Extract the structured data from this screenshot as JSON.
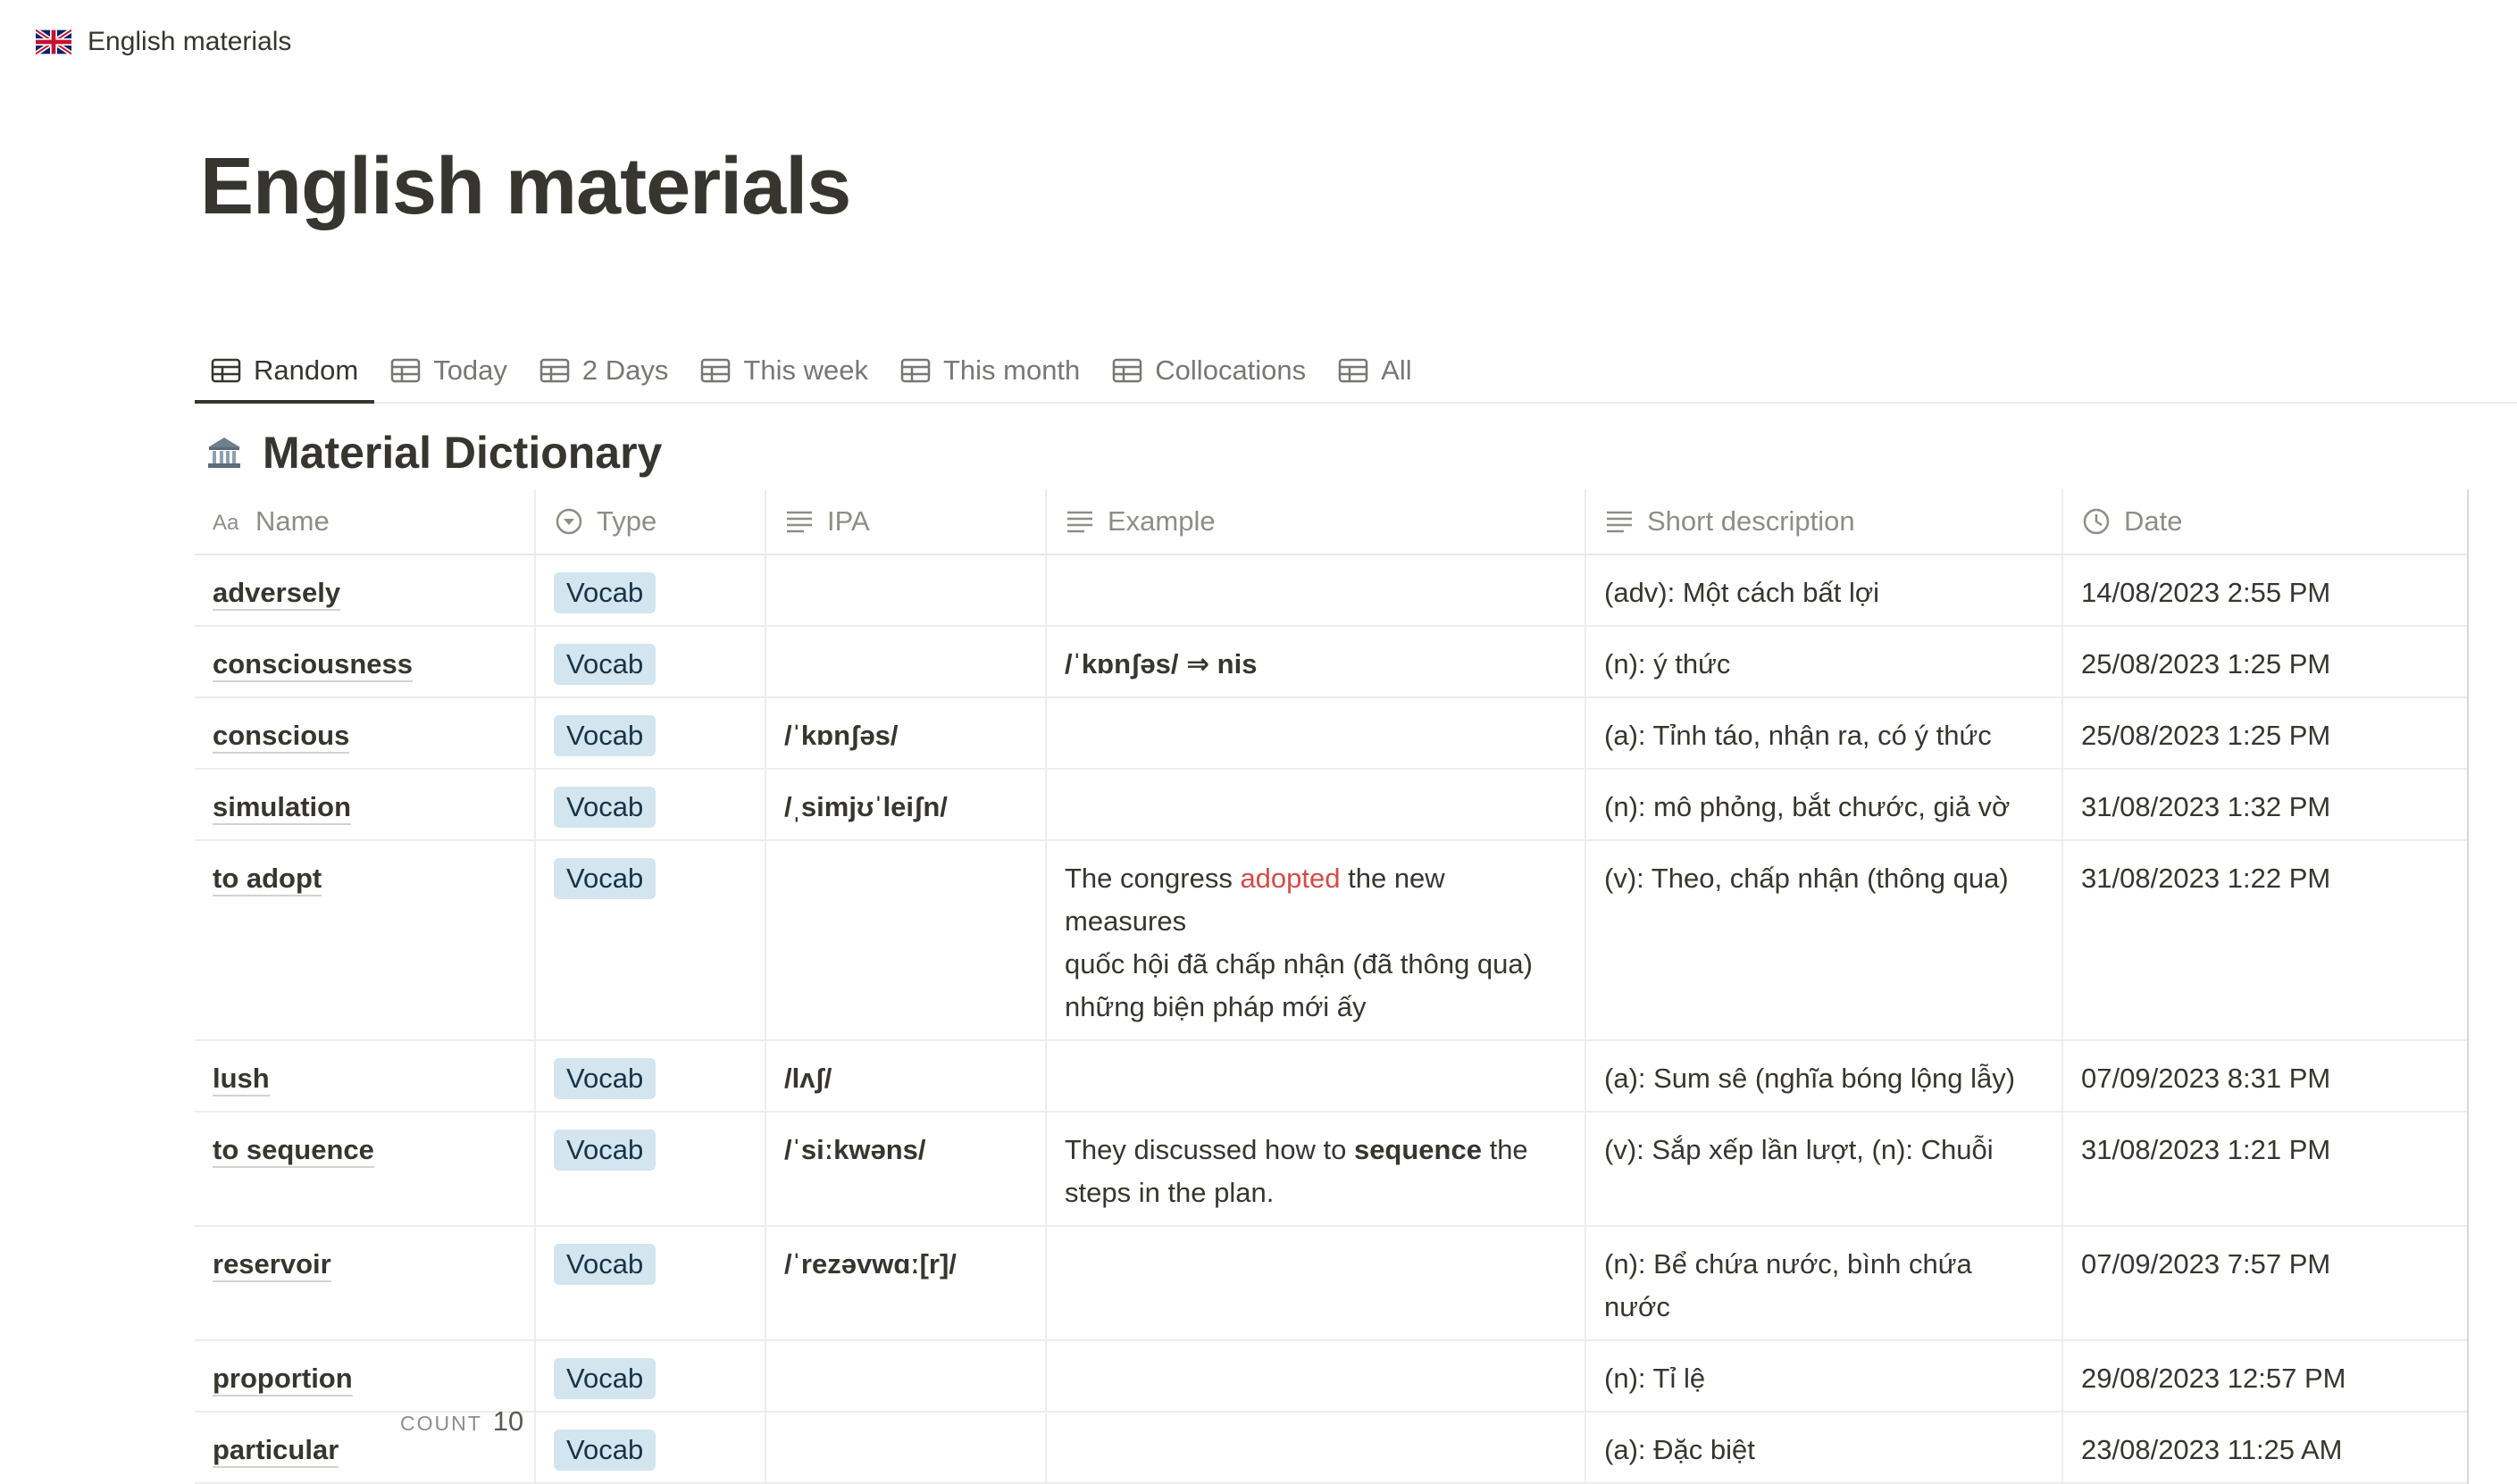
{
  "breadcrumb": {
    "icon": "uk-flag-icon",
    "label": "English materials"
  },
  "page": {
    "title": "English materials"
  },
  "tabs": [
    {
      "label": "Random",
      "icon": "table-icon",
      "active": true
    },
    {
      "label": "Today",
      "icon": "table-icon"
    },
    {
      "label": "2 Days",
      "icon": "table-icon"
    },
    {
      "label": "This week",
      "icon": "table-icon"
    },
    {
      "label": "This month",
      "icon": "table-icon"
    },
    {
      "label": "Collocations",
      "icon": "table-icon"
    },
    {
      "label": "All",
      "icon": "table-icon"
    }
  ],
  "database": {
    "icon": "bank-building-icon",
    "title": "Material Dictionary"
  },
  "table": {
    "columns": [
      {
        "label": "Name",
        "icon": "title-aa-icon"
      },
      {
        "label": "Type",
        "icon": "select-icon"
      },
      {
        "label": "IPA",
        "icon": "text-lines-icon"
      },
      {
        "label": "Example",
        "icon": "text-lines-icon"
      },
      {
        "label": "Short description",
        "icon": "text-lines-icon"
      },
      {
        "label": "Date",
        "icon": "clock-icon"
      }
    ],
    "rows": [
      {
        "name": "adversely",
        "type": "Vocab",
        "ipa": "",
        "example": "",
        "short": "(adv): Một cách bất lợi",
        "date": "14/08/2023 2:55 PM"
      },
      {
        "name": "consciousness",
        "type": "Vocab",
        "ipa": "",
        "example": "/ˈkɒnʃəs/ ⇒ nis",
        "short": "(n): ý thức",
        "date": "25/08/2023 1:25 PM"
      },
      {
        "name": "conscious",
        "type": "Vocab",
        "ipa": "/ˈkɒnʃəs/",
        "example": "",
        "short": "(a): Tỉnh táo, nhận ra, có ý thức",
        "date": "25/08/2023 1:25 PM"
      },
      {
        "name": "simulation",
        "type": "Vocab",
        "ipa": "/ˌsimjʊˈleiʃn/",
        "example": "",
        "short": "(n): mô phỏng, bắt chước, giả vờ",
        "date": "31/08/2023 1:32 PM"
      },
      {
        "name": "to adopt",
        "type": "Vocab",
        "ipa": "",
        "example": "",
        "short": "(v): Theo, chấp nhận (thông qua)",
        "date": "31/08/2023 1:22 PM",
        "example_parts": {
          "pre": "The congress ",
          "highlight": "adopted",
          "post": " the new measures",
          "translation": "quốc hội đã chấp nhận (đã thông qua) những biện pháp mới ấy"
        }
      },
      {
        "name": "lush",
        "type": "Vocab",
        "ipa": "/lʌʃ/",
        "example": "",
        "short": "(a): Sum sê (nghĩa bóng lộng lẫy)",
        "date": "07/09/2023 8:31 PM"
      },
      {
        "name": "to sequence",
        "type": "Vocab",
        "ipa": "/ˈsiːkwəns/",
        "example": "",
        "short": "(v): Sắp xếp lần lượt, (n): Chuỗi",
        "date": "31/08/2023 1:21 PM",
        "example_parts": {
          "pre": "They discussed how to ",
          "bold": "sequence",
          "post": " the steps in the plan."
        }
      },
      {
        "name": "reservoir",
        "type": "Vocab",
        "ipa": "/ˈrezəvwɑː[r]/",
        "example": "",
        "short": "(n): Bể chứa nước, bình chứa nước",
        "date": "07/09/2023 7:57 PM"
      },
      {
        "name": "proportion",
        "type": "Vocab",
        "ipa": "",
        "example": "",
        "short": "(n): Tỉ lệ",
        "date": "29/08/2023 12:57 PM"
      },
      {
        "name": "particular",
        "type": "Vocab",
        "ipa": "",
        "example": "",
        "short": "(a): Đặc biệt",
        "date": "23/08/2023 11:25 AM"
      }
    ]
  },
  "footer": {
    "count_label": "COUNT",
    "count_value": "10"
  },
  "colors": {
    "text": "#37352f",
    "muted": "#8e8d88",
    "badge_bg": "#d3e5ef",
    "badge_text": "#183347",
    "highlight": "#d44c47",
    "border": "#ededec"
  }
}
